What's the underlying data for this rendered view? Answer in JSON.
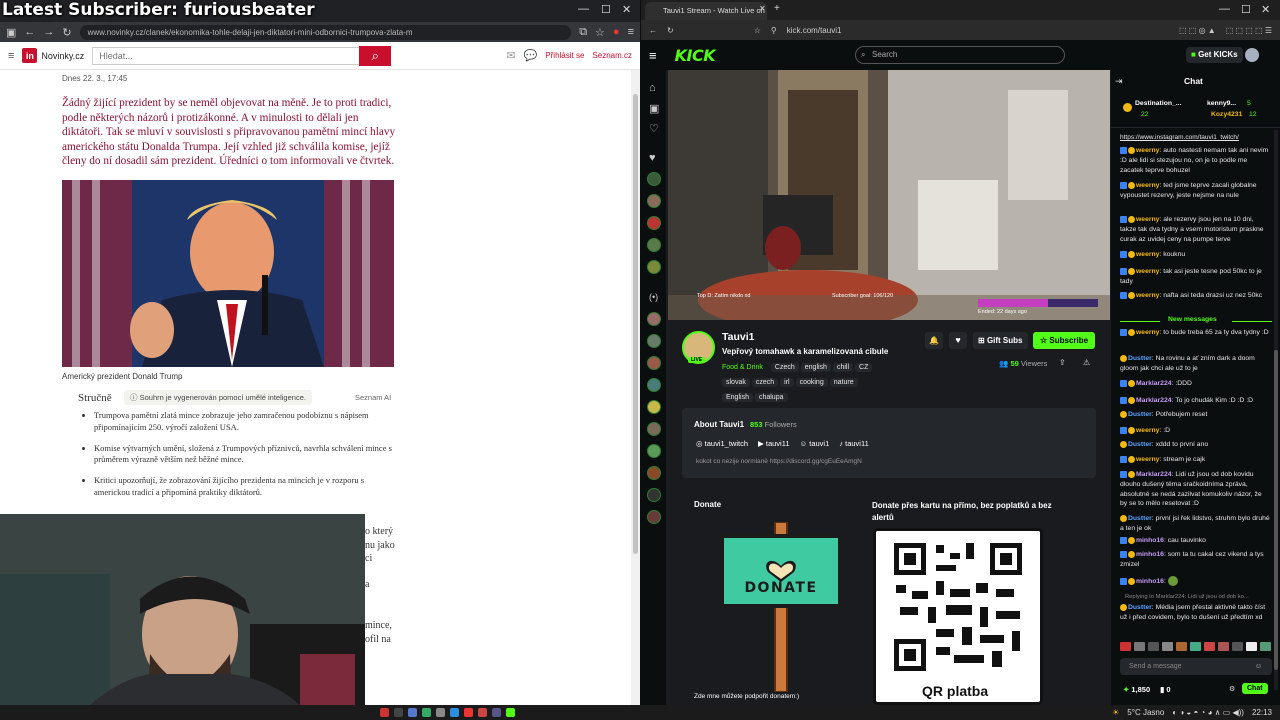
{
  "overlay": {
    "title": "Latest Subscriber: furiousbeater"
  },
  "left_browser": {
    "url": "www.novinky.cz/clanek/ekonomika-tohle-delaji-jen-diktatori-mini-odbornici-trumpova-zlata-m",
    "site": {
      "name": "Novinky.cz",
      "logo": "in",
      "search_placeholder": "Hledat...",
      "login": "Přihlásit se",
      "seznam": "Seznam.cz"
    },
    "article": {
      "date": "Dnes 22. 3., 17:45",
      "lead": "Žádný žijící prezident by se neměl objevovat na měně. Je to proti tradici, podle některých názorů i protizákonné. A v minulosti to dělali jen diktátoři. Tak se mluví v souvislosti s připravovanou pamětní mincí hlavy amerického státu Donalda Trumpa. Její vzhled již schválila komise, jejíž členy do ní dosadil sám prezident. Úředníci o tom informovali ve čtvrtek.",
      "caption": "Americký prezident Donald Trump",
      "summary_title": "Stručně",
      "ai_notice": "Souhrn je vygenerován pomocí umělé inteligence.",
      "ai_source": "Seznam AI",
      "bullets": [
        "Trumpova pamětní zlatá mince zobrazuje jeho zamračenou podobiznu s nápisem připomínajícím 250. výročí založení USA.",
        "Komise výtvarných umění, složená z Trumpových příznivců, navrhla schválení mince s průměrem výrazně větším než běžné mince.",
        "Kritici upozorňují, že zobrazování žijícího prezidenta na mincích je v rozporu s americkou tradicí a připomíná praktiky diktátorů."
      ],
      "frag": [
        "o který",
        "nu jako",
        "ci",
        "a",
        "",
        "mince,",
        "ofil na"
      ]
    }
  },
  "right_browser": {
    "tab_title": "Tauvi1 Stream - Watch Live on",
    "url": "kick.com/tauvi1",
    "search_placeholder": "Search",
    "get_kicks": "Get KICKs",
    "video": {
      "top_donor": "Top D: Zatím nikdo xd",
      "sub_goal": "Subscriber goal: 106/120",
      "ended": "Ended: 22 days ago"
    },
    "channel": {
      "name": "Tauvi1",
      "title": "Vepřový tomahawk a karamelizovaná cibule",
      "category": "Food & Drink",
      "tags_row1": [
        "Czech",
        "english",
        "chill",
        "CZ"
      ],
      "tags_row2": [
        "slovak",
        "czech",
        "irl",
        "cooking",
        "nature"
      ],
      "tags_row3": [
        "English",
        "chalupa"
      ],
      "viewers": "59",
      "viewers_label": "Viewers",
      "live": "LIVE",
      "gift": "Gift Subs",
      "subscribe": "Subscribe"
    },
    "about": {
      "title": "About Tauvi1",
      "followers": "853",
      "followers_label": "Followers",
      "socials": [
        "tauvi1_twitch",
        "tauvi11",
        "tauvi1",
        "tauvi11"
      ],
      "desc": "kokot co nezije normlaně https://discord.gg/cgEuEeAmgN"
    },
    "donate": {
      "left_title": "Donate",
      "sign": "DONATE",
      "left_note": "Zde mne můžete podpořit donatem:)",
      "right_title": "Donate přes kartu na přímo, bez poplatků a bez alertů",
      "qr": "QR platba"
    },
    "chat": {
      "title": "Chat",
      "pinned": {
        "user1": "Destination_...",
        "count": "22",
        "user2": "kenny9...",
        "user3": "Kozy4231",
        "count2": "5",
        "count3": "12"
      },
      "link": "https://www.instagram.com/tauvi1_twitch/",
      "messages": [
        {
          "user": "weerny",
          "text": "auto nastesti nemam tak ani nevim :D ale lidi si stezujou no, on je to podle me zacatek teprve bohuzel",
          "color": "#f2b90f"
        },
        {
          "user": "weerny",
          "text": "ted jsme teprve zacali globalne vypoustet rezervy, jeste nejsme na nule",
          "color": "#f2b90f"
        },
        {
          "user": "weerny",
          "text": "ale rezervy jsou jen na 10 dni, takze tak dva tydny a vsem motoristum praskne curak az uvidej ceny na pumpe terve",
          "color": "#f2b90f"
        },
        {
          "user": "weerny",
          "text": "kouknu",
          "color": "#f2b90f"
        },
        {
          "user": "weerny",
          "text": "tak asi jeste tesne pod 50kc to je tady",
          "color": "#f2b90f"
        },
        {
          "user": "weerny",
          "text": "nafta asi teda drazsi uz nez 50kc",
          "color": "#f2b90f"
        },
        {
          "user": "weerny",
          "text": "to bude treba 65 za ty dva tydny :D",
          "color": "#f2b90f"
        },
        {
          "user": "Dustter",
          "text": "Na rovinu a ať zním dark a doom gloom jak chci ale už to je",
          "color": "#5aa2ff"
        },
        {
          "user": "Marklar224",
          "text": ":DDD",
          "color": "#c79cf7"
        },
        {
          "user": "Marklar224",
          "text": "To jo chudák Kim :D :D :D",
          "color": "#c79cf7"
        },
        {
          "user": "Dustter",
          "text": "Potřebujem reset",
          "color": "#5aa2ff"
        },
        {
          "user": "weerny",
          "text": ":D",
          "color": "#f2b90f"
        },
        {
          "user": "Dustter",
          "text": "xddd to první ano",
          "color": "#5aa2ff"
        },
        {
          "user": "weerny",
          "text": "stream je cajk",
          "color": "#f2b90f"
        },
        {
          "user": "Marklar224",
          "text": "Lidi už jsou od dob kovidu dlouho dušený těma sračkoidníma zpráva, absolutně se nedá zazilvat komukoliv názor, že by se to mělo resetovat :D",
          "color": "#c79cf7"
        },
        {
          "user": "Dustter",
          "text": "první jsi řek lidstvo, struhm bylo druhé a ten je ok",
          "color": "#5aa2ff"
        },
        {
          "user": "minho16",
          "text": "cau tauvinko",
          "color": "#c79cf7"
        },
        {
          "user": "minho16",
          "text": "som ta tu cakal cez vikend a tys zmizel",
          "color": "#c79cf7"
        },
        {
          "user": "minho16",
          "text": "",
          "color": "#c79cf7"
        },
        {
          "user": "Dustter",
          "text": "Média jsem přestal aktivně takto číst už i před covidem, bylo to dušení už předtím xd",
          "color": "#5aa2ff"
        }
      ],
      "new_messages": "New messages",
      "replying": "Replying to Marklar224: Lidi už jsou od dob ko...",
      "input_placeholder": "Send a message",
      "points": "1,850",
      "points2": "0",
      "send": "Chat"
    }
  },
  "taskbar": {
    "weather": "5°C Jasno",
    "time": "22:13"
  }
}
